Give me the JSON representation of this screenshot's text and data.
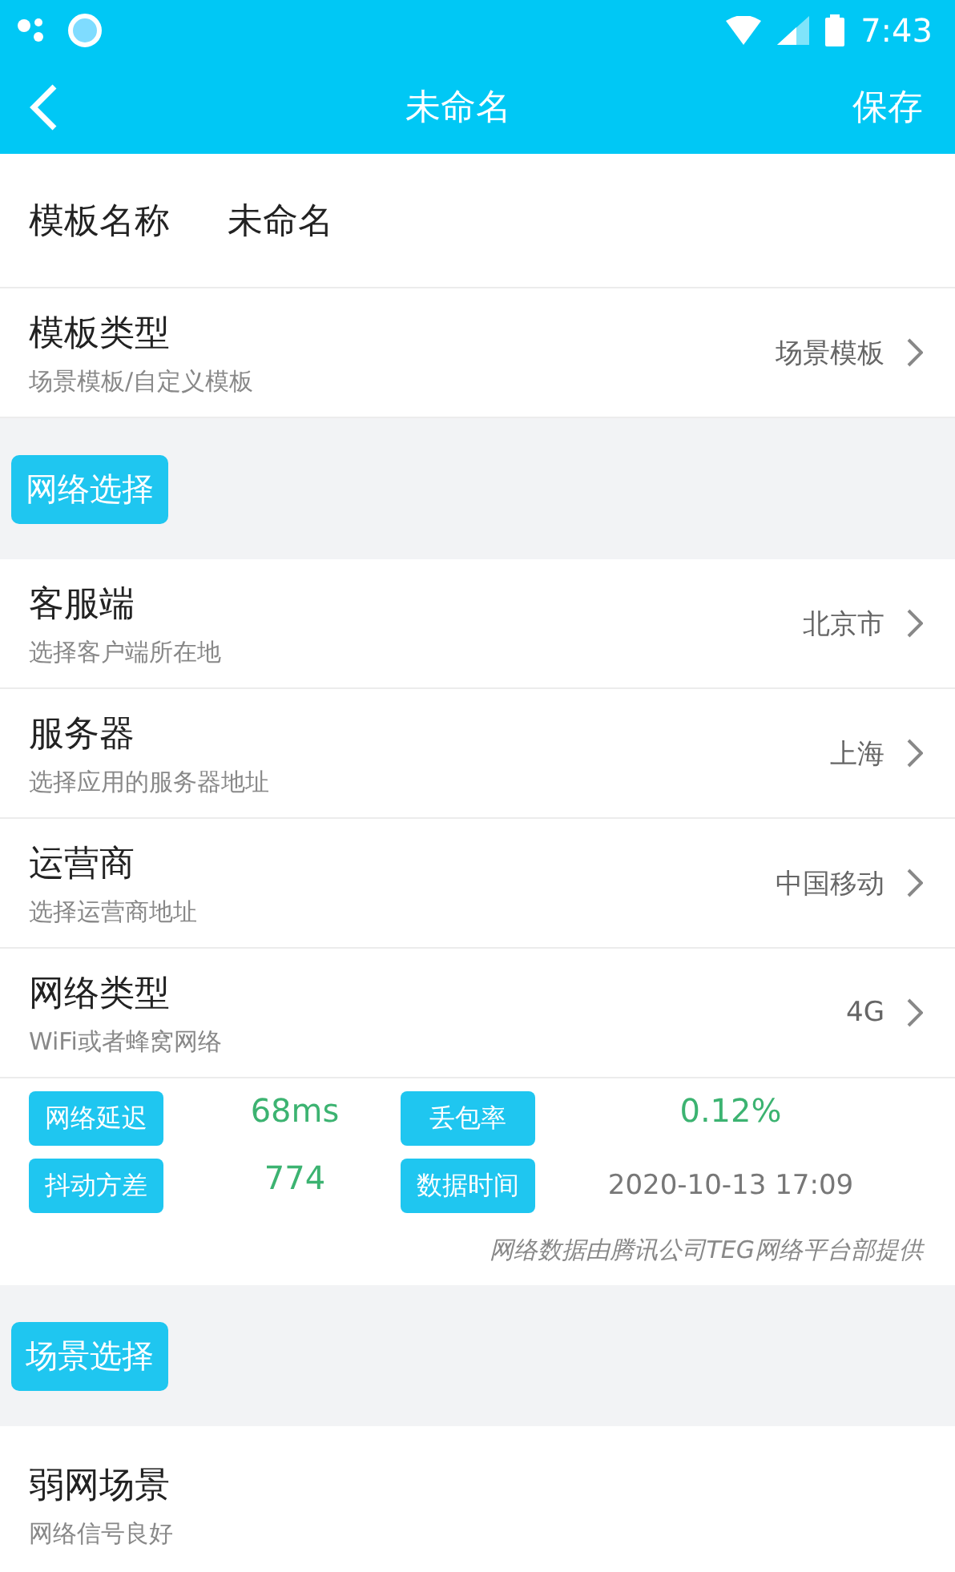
{
  "status_bar": {
    "time": "7:43"
  },
  "toolbar": {
    "title": "未命名",
    "action": "保存"
  },
  "template": {
    "name_label": "模板名称",
    "name_value": "未命名",
    "type_label": "模板类型",
    "type_hint": "场景模板/自定义模板",
    "type_value": "场景模板"
  },
  "network_section": {
    "chip": "网络选择",
    "rows": [
      {
        "label": "客服端",
        "hint": "选择客户端所在地",
        "value": "北京市"
      },
      {
        "label": "服务器",
        "hint": "选择应用的服务器地址",
        "value": "上海"
      },
      {
        "label": "运营商",
        "hint": "选择运营商地址",
        "value": "中国移动"
      },
      {
        "label": "网络类型",
        "hint": "WiFi或者蜂窝网络",
        "value": "4G"
      }
    ],
    "metrics": [
      {
        "label": "网络延迟",
        "value": "68ms",
        "kind": "good"
      },
      {
        "label": "丢包率",
        "value": "0.12%",
        "kind": "good"
      },
      {
        "label": "抖动方差",
        "value": "774",
        "kind": "good"
      },
      {
        "label": "数据时间",
        "value": "2020-10-13 17:09",
        "kind": "plain"
      }
    ],
    "credit": "网络数据由腾讯公司TEG网络平台部提供"
  },
  "scene_section": {
    "chip": "场景选择",
    "rows": [
      {
        "label": "弱网场景",
        "hint": "网络信号良好"
      }
    ]
  }
}
